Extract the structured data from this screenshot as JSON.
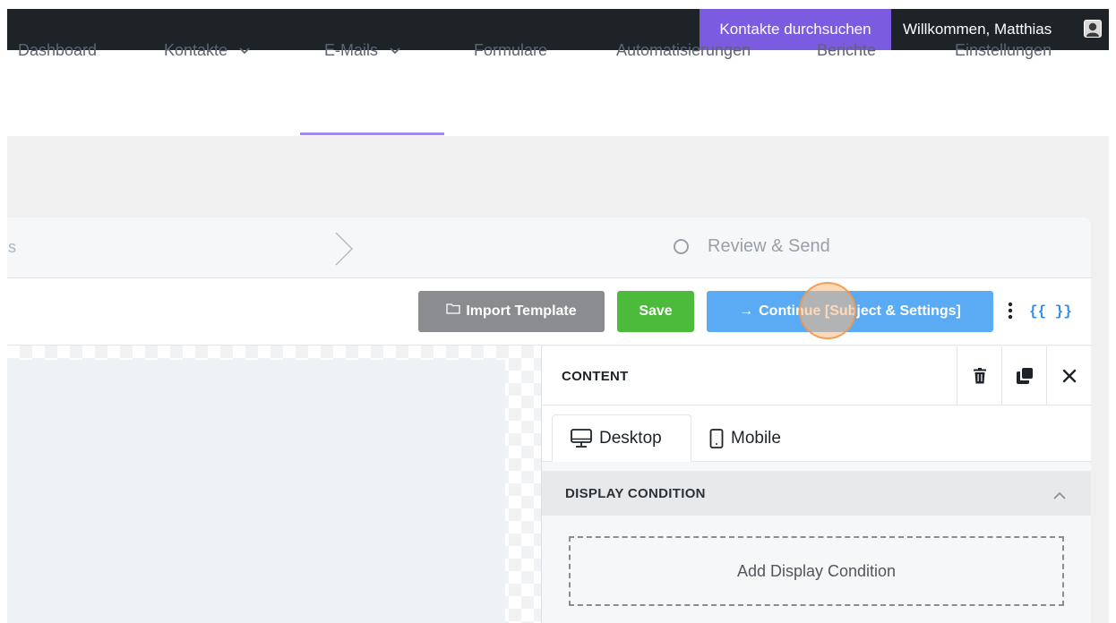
{
  "topbar": {
    "search_label": "Kontakte durchsuchen",
    "welcome_text": "Willkommen, Matthias",
    "avatar_icon": "user-avatar-icon"
  },
  "nav": {
    "items": [
      {
        "label": "Dashboard",
        "has_dropdown": false
      },
      {
        "label": "Kontakte",
        "has_dropdown": true
      },
      {
        "label": "E-Mails",
        "has_dropdown": true,
        "active": true
      },
      {
        "label": "Formulare",
        "has_dropdown": false
      },
      {
        "label": "Automatisierungen",
        "has_dropdown": false
      },
      {
        "label": "Berichte",
        "has_dropdown": false
      },
      {
        "label": "Einstellungen",
        "has_dropdown": false
      }
    ],
    "active_color": "#a18aec"
  },
  "steps": {
    "previous_fragment": "s",
    "review_label": "Review & Send"
  },
  "toolbar": {
    "import_label": "Import Template",
    "save_label": "Save",
    "continue_label": "Continue [Subject & Settings]",
    "merge_tags_label": "{{ }}"
  },
  "panel": {
    "title": "CONTENT",
    "tabs": [
      {
        "label": "Desktop",
        "icon": "desktop-icon",
        "active": true
      },
      {
        "label": "Mobile",
        "icon": "mobile-icon",
        "active": false
      }
    ],
    "display_condition": {
      "title": "DISPLAY CONDITION",
      "add_label": "Add Display Condition"
    }
  },
  "colors": {
    "topbar_bg": "#1d2327",
    "search_bg": "#7b5ce0",
    "import_bg": "#8a8c8f",
    "save_bg": "#4cbb3c",
    "continue_bg": "#5aabf4",
    "merge_tags": "#2d8cf0"
  }
}
